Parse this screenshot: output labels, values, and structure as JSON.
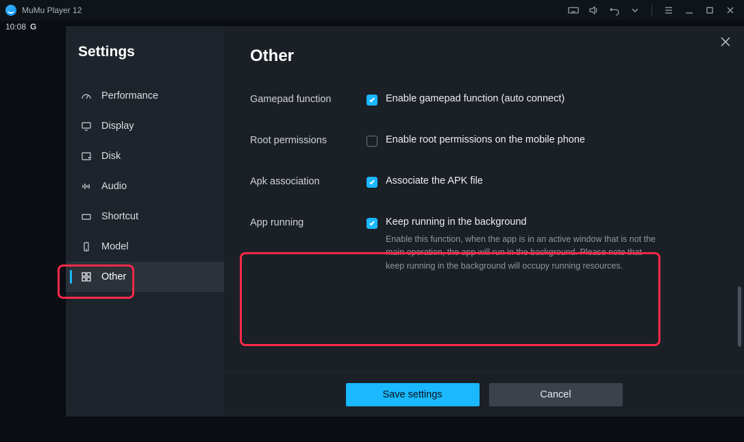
{
  "titlebar": {
    "app_title": "MuMu Player 12"
  },
  "status": {
    "time": "10:08",
    "letter": "G"
  },
  "sidebar": {
    "title": "Settings",
    "items": [
      {
        "label": "Performance"
      },
      {
        "label": "Display"
      },
      {
        "label": "Disk"
      },
      {
        "label": "Audio"
      },
      {
        "label": "Shortcut"
      },
      {
        "label": "Model"
      },
      {
        "label": "Other"
      }
    ]
  },
  "content": {
    "title": "Other",
    "sections": {
      "gamepad": {
        "label": "Gamepad function",
        "option": "Enable gamepad function (auto connect)"
      },
      "root": {
        "label": "Root permissions",
        "option": "Enable root permissions on the mobile phone"
      },
      "apk": {
        "label": "Apk association",
        "option": "Associate the APK file"
      },
      "app_running": {
        "label": "App running",
        "option": "Keep running in the background",
        "desc": "Enable this function, when the app is in an active window that is not the main operation, the app will run in the background. Please note that keep running in the background will occupy running resources."
      }
    }
  },
  "footer": {
    "save": "Save settings",
    "cancel": "Cancel"
  }
}
